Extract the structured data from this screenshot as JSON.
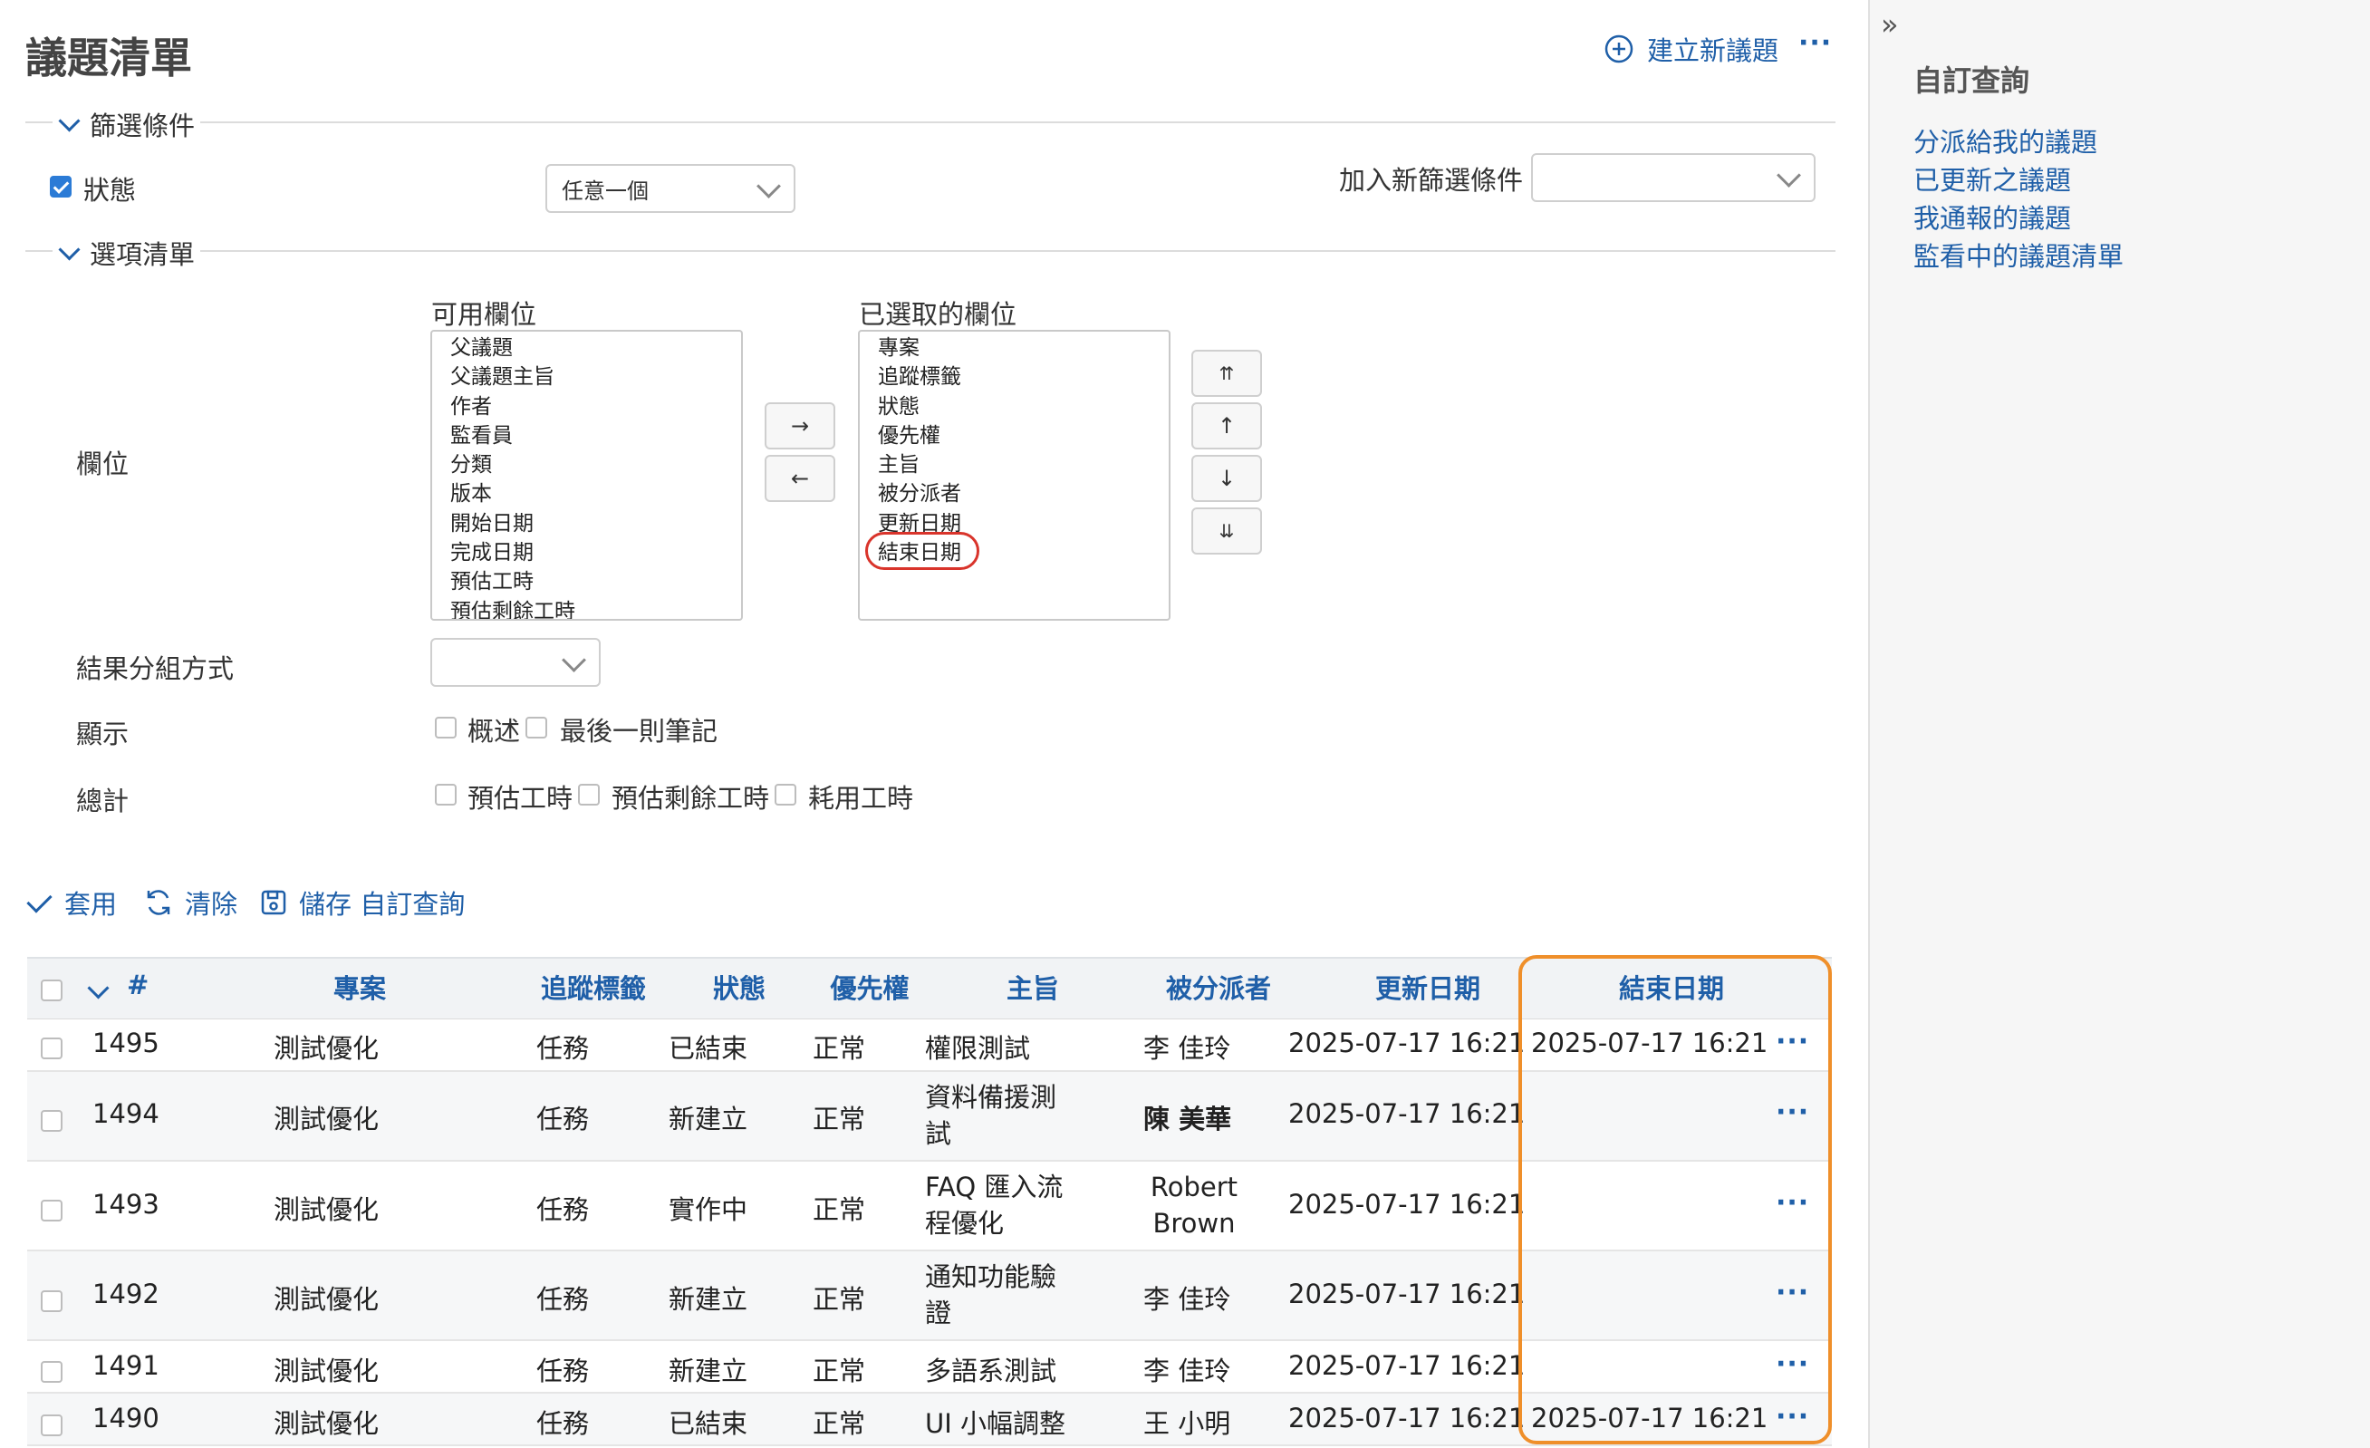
{
  "page": {
    "title": "議題清單",
    "new_issue_label": "建立新議題"
  },
  "filters": {
    "legend": "篩選條件",
    "status_label": "狀態",
    "status_operator": "任意一個",
    "add_filter_label": "加入新篩選條件",
    "add_filter_value": ""
  },
  "options": {
    "legend": "選項清單",
    "columns_label": "欄位",
    "available_label": "可用欄位",
    "selected_label": "已選取的欄位",
    "available_columns": [
      "父議題",
      "父議題主旨",
      "作者",
      "監看員",
      "分類",
      "版本",
      "開始日期",
      "完成日期",
      "預估工時",
      "預估剩餘工時"
    ],
    "selected_columns": [
      "專案",
      "追蹤標籤",
      "狀態",
      "優先權",
      "主旨",
      "被分派者",
      "更新日期",
      "結束日期"
    ],
    "group_by_label": "結果分組方式",
    "group_by_value": "",
    "show_label": "顯示",
    "show_options": [
      "概述",
      "最後一則筆記"
    ],
    "totals_label": "總計",
    "totals_options": [
      "預估工時",
      "預估剩餘工時",
      "耗用工時"
    ]
  },
  "actions": {
    "apply": "套用",
    "clear": "清除",
    "save": "儲存 自訂查詢"
  },
  "table": {
    "headers": [
      "#",
      "專案",
      "追蹤標籤",
      "狀態",
      "優先權",
      "主旨",
      "被分派者",
      "更新日期",
      "結束日期"
    ],
    "rows": [
      {
        "id": "1495",
        "project": "測試優化",
        "tracker": "任務",
        "status": "已結束",
        "priority": "正常",
        "subject": "權限測試",
        "assignee": "李 佳玲",
        "updated": "2025-07-17 16:21",
        "closed": "2025-07-17 16:21"
      },
      {
        "id": "1494",
        "project": "測試優化",
        "tracker": "任務",
        "status": "新建立",
        "priority": "正常",
        "subject": "資料備援測試",
        "assignee": "陳 美華",
        "updated": "2025-07-17 16:21",
        "closed": ""
      },
      {
        "id": "1493",
        "project": "測試優化",
        "tracker": "任務",
        "status": "實作中",
        "priority": "正常",
        "subject": "FAQ 匯入流程優化",
        "assignee": "Robert Brown",
        "updated": "2025-07-17 16:21",
        "closed": ""
      },
      {
        "id": "1492",
        "project": "測試優化",
        "tracker": "任務",
        "status": "新建立",
        "priority": "正常",
        "subject": "通知功能驗證",
        "assignee": "李 佳玲",
        "updated": "2025-07-17 16:21",
        "closed": ""
      },
      {
        "id": "1491",
        "project": "測試優化",
        "tracker": "任務",
        "status": "新建立",
        "priority": "正常",
        "subject": "多語系測試",
        "assignee": "李 佳玲",
        "updated": "2025-07-17 16:21",
        "closed": ""
      },
      {
        "id": "1490",
        "project": "測試優化",
        "tracker": "任務",
        "status": "已結束",
        "priority": "正常",
        "subject": "UI 小幅調整",
        "assignee": "王 小明",
        "updated": "2025-07-17 16:21",
        "closed": "2025-07-17 16:21"
      }
    ]
  },
  "sidebar": {
    "title": "自訂查詢",
    "links": [
      "分派給我的議題",
      "已更新之議題",
      "我通報的議題",
      "監看中的議題清單"
    ]
  },
  "colors": {
    "link": "#1f5fa8",
    "highlight_orange": "#ef8f2a",
    "highlight_red": "#d9342b"
  }
}
